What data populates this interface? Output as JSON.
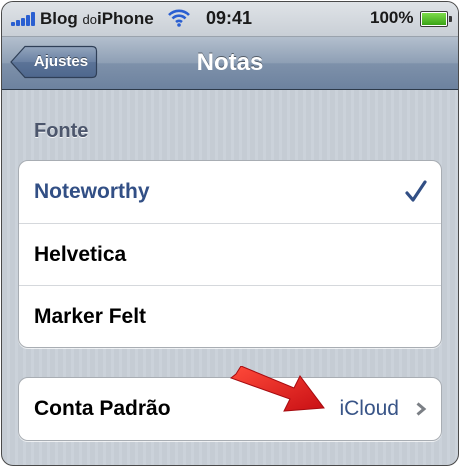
{
  "status_bar": {
    "carrier_main": "Blog",
    "carrier_small": "do",
    "carrier_end": "iPhone",
    "time": "09:41",
    "battery": "100%",
    "battery_level": 1.0
  },
  "nav_bar": {
    "back_label": "Ajustes",
    "title": "Notas"
  },
  "font_section": {
    "header": "Fonte",
    "options": [
      {
        "label": "Noteworthy",
        "selected": true
      },
      {
        "label": "Helvetica",
        "selected": false
      },
      {
        "label": "Marker Felt",
        "selected": false
      }
    ]
  },
  "account_section": {
    "label": "Conta Padrão",
    "value": "iCloud"
  },
  "colors": {
    "selected_text": "#324f85",
    "detail_text": "#385487",
    "annotation_arrow": "#e3161b"
  },
  "icons": {
    "signal": "signal-bars-icon",
    "wifi": "wifi-icon",
    "battery": "battery-icon",
    "checkmark": "checkmark-icon",
    "chevron": "chevron-right-icon",
    "annotation": "red-arrow-icon"
  }
}
